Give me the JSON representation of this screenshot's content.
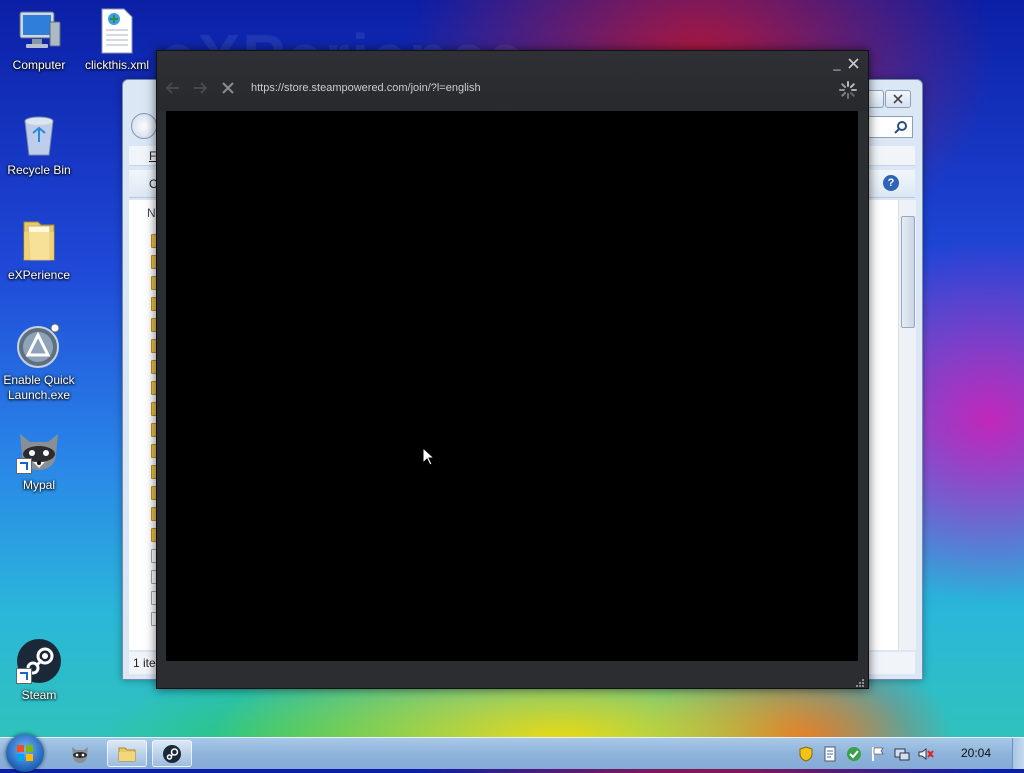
{
  "wallpaper": {
    "watermark": "eXPerience"
  },
  "desktop": {
    "icons": [
      {
        "label": "Computer",
        "icon": "computer-icon"
      },
      {
        "label": "clickthis.xml",
        "icon": "xml-file-icon"
      },
      {
        "label": "Recycle Bin",
        "icon": "recycle-bin-icon"
      },
      {
        "label": "eXPerience",
        "icon": "folder-icon"
      },
      {
        "label": "Enable Quick Launch.exe",
        "icon": "quick-launch-app-icon"
      },
      {
        "label": "Mypal",
        "icon": "mypal-raccoon-icon"
      },
      {
        "label": "Steam",
        "icon": "steam-icon"
      }
    ]
  },
  "explorer": {
    "menu_first": "F",
    "cmd_first": "O",
    "col_first": "N",
    "status": "1 ite"
  },
  "steam_window": {
    "url": "https://store.steampowered.com/join/?l=english",
    "minimize": "_",
    "close": "✕",
    "back": "←",
    "forward": "→",
    "stop": "✕"
  },
  "taskbar": {
    "clock": "20:04",
    "pinned": [
      "mypal-raccoon-icon",
      "explorer-folder-icon",
      "steam-icon"
    ]
  }
}
